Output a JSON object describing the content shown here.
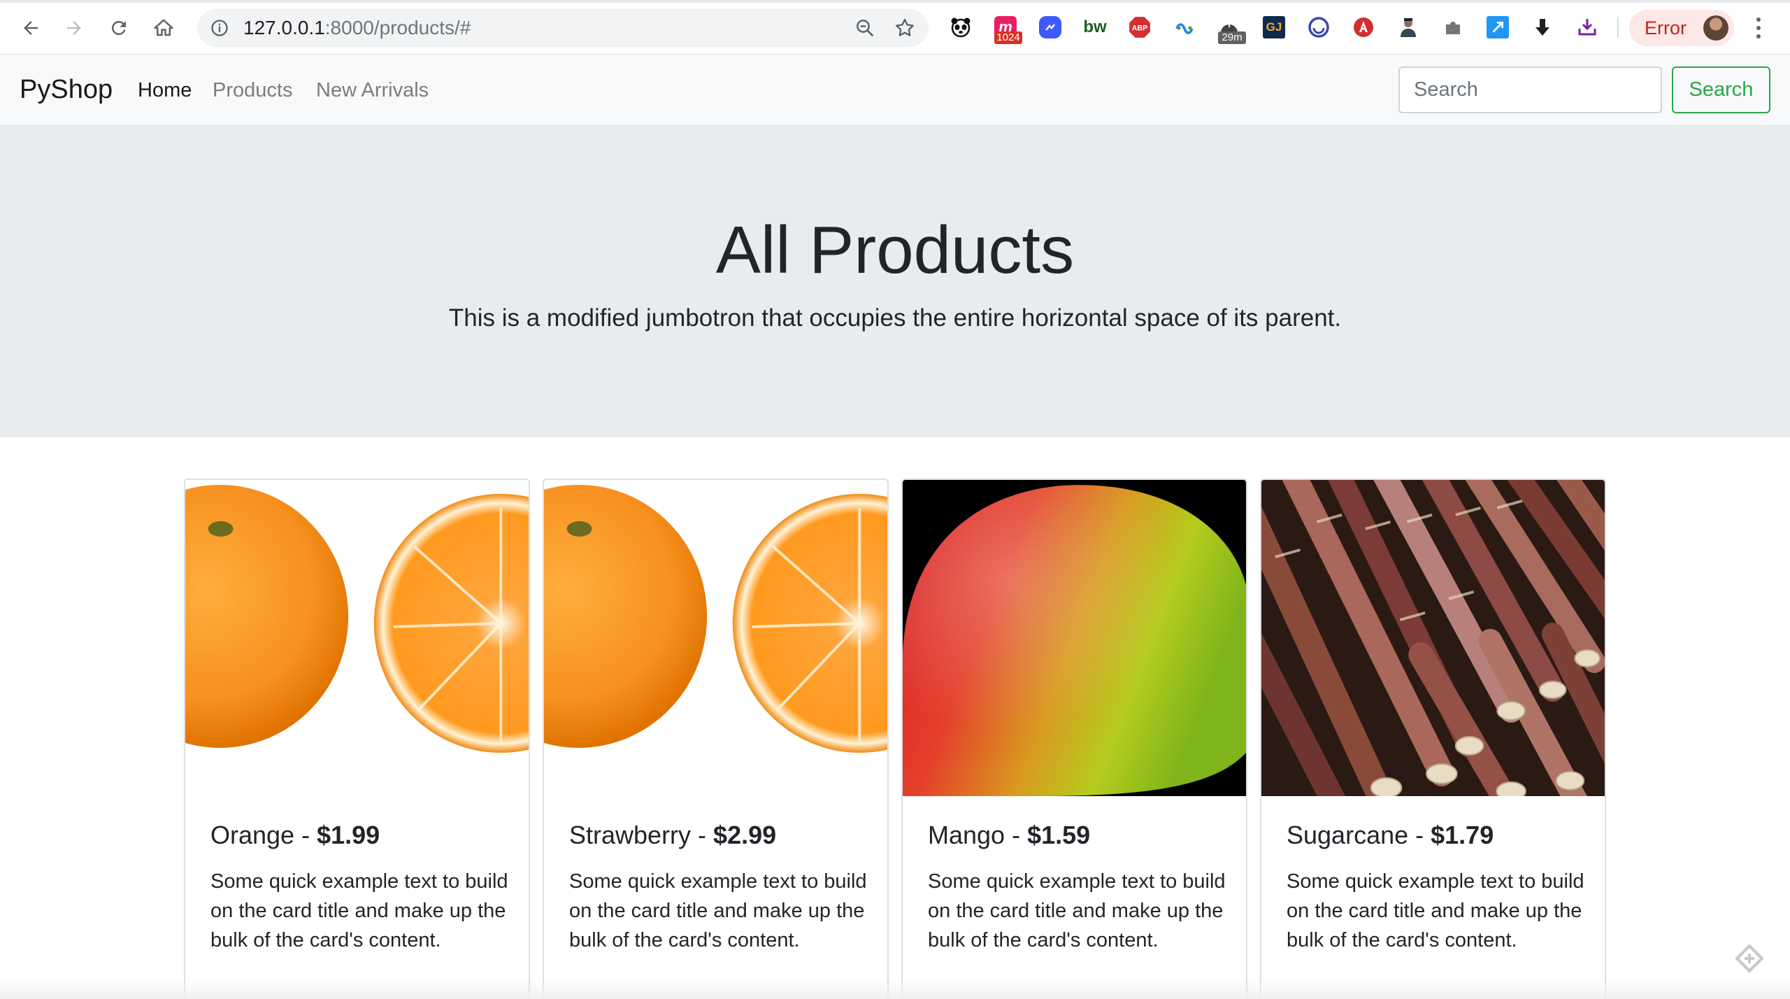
{
  "browser": {
    "url_host": "127.0.0.1",
    "url_rest": ":8000/products/#",
    "extension_badges": {
      "m_ext": "1024",
      "timer_ext": "29m"
    },
    "extension_texts": {
      "bw": "bw",
      "abp": "ABP",
      "gj": "GJ"
    },
    "profile_status": "Error"
  },
  "navbar": {
    "brand": "PyShop",
    "links": [
      {
        "label": "Home",
        "active": true
      },
      {
        "label": "Products",
        "active": false
      },
      {
        "label": "New Arrivals",
        "active": false
      }
    ],
    "search_placeholder": "Search",
    "search_button": "Search"
  },
  "jumbotron": {
    "title": "All Products",
    "lead": "This is a modified jumbotron that occupies the entire horizontal space of its parent."
  },
  "cards": [
    {
      "name": "Orange",
      "sep": " - ",
      "price": "$1.99",
      "image": "orange-image",
      "text": "Some quick example text to build on the card title and make up the bulk of the card's content."
    },
    {
      "name": "Strawberry",
      "sep": " - ",
      "price": "$2.99",
      "image": "orange-image",
      "text": "Some quick example text to build on the card title and make up the bulk of the card's content."
    },
    {
      "name": "Mango",
      "sep": " - ",
      "price": "$1.59",
      "image": "mango-image",
      "text": "Some quick example text to build on the card title and make up the bulk of the card's content."
    },
    {
      "name": "Sugarcane",
      "sep": " - ",
      "price": "$1.79",
      "image": "sugarcane-image",
      "text": "Some quick example text to build on the card title and make up the bulk of the card's content."
    }
  ],
  "colors": {
    "navbar_bg": "#f8f9fa",
    "jumbotron_bg": "#e9ecef",
    "success": "#28a745",
    "error_text": "#c5221f"
  }
}
